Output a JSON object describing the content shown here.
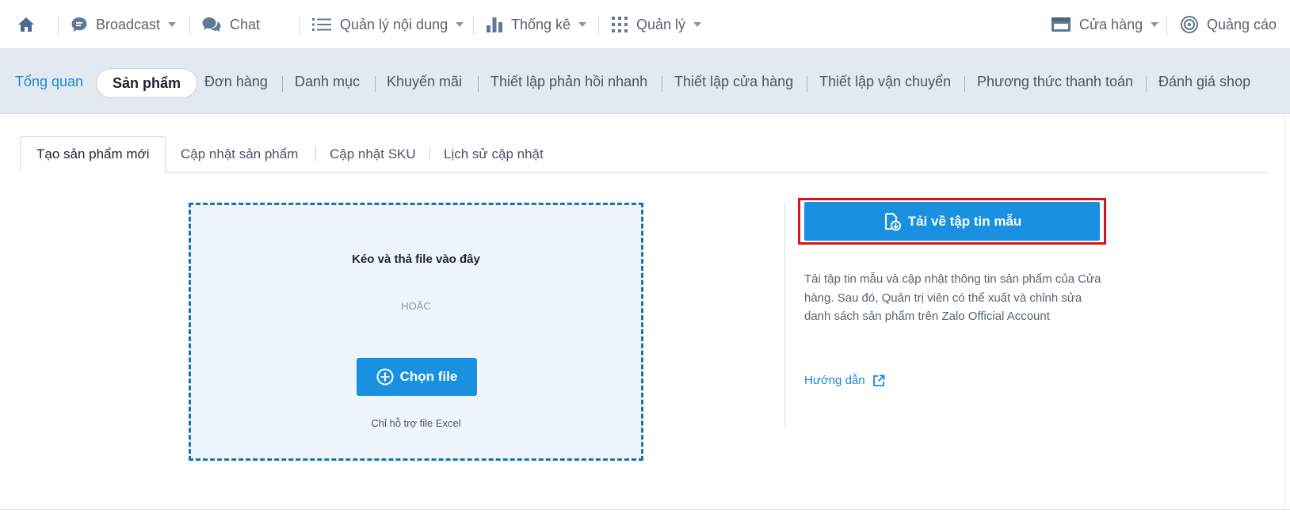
{
  "topnav": {
    "home_icon": "home-icon",
    "broadcast": "Broadcast",
    "chat": "Chat",
    "content": "Quản lý nội dung",
    "stats": "Thống kê",
    "manage": "Quản lý",
    "store": "Cửa hàng",
    "ads": "Quảng cáo"
  },
  "subnav": {
    "items": [
      "Tổng quan",
      "Sản phẩm",
      "Đơn hàng",
      "Danh mục",
      "Khuyến mãi",
      "Thiết lập phản hồi nhanh",
      "Thiết lập cửa hàng",
      "Thiết lập vận chuyển",
      "Phương thức thanh toán",
      "Đánh giá shop"
    ],
    "active_index": 1
  },
  "tabs": {
    "items": [
      "Tạo sản phẩm mới",
      "Cập nhật sản phẩm",
      "Cập nhật SKU",
      "Lịch sử cập nhật"
    ],
    "active_index": 0
  },
  "upload": {
    "title": "Kéo và thả file vào đây",
    "or": "HOẶC",
    "choose_label": "Chọn file",
    "note": "Chỉ hỗ trợ file Excel"
  },
  "template": {
    "download_label": "Tải về tập tin mẫu",
    "description": "Tải tập tin mẫu và cập nhật thông tin sản phẩm của Cửa hàng. Sau đó, Quản trị viên có thể xuất và chỉnh sửa danh sách sản phẩm trên Zalo Official Account",
    "guide_label": "Hướng dẫn"
  },
  "colors": {
    "accent": "#1991e0",
    "link": "#1a8ad4",
    "highlight": "#d9121b",
    "subnav_bg": "#e3e9f1"
  }
}
